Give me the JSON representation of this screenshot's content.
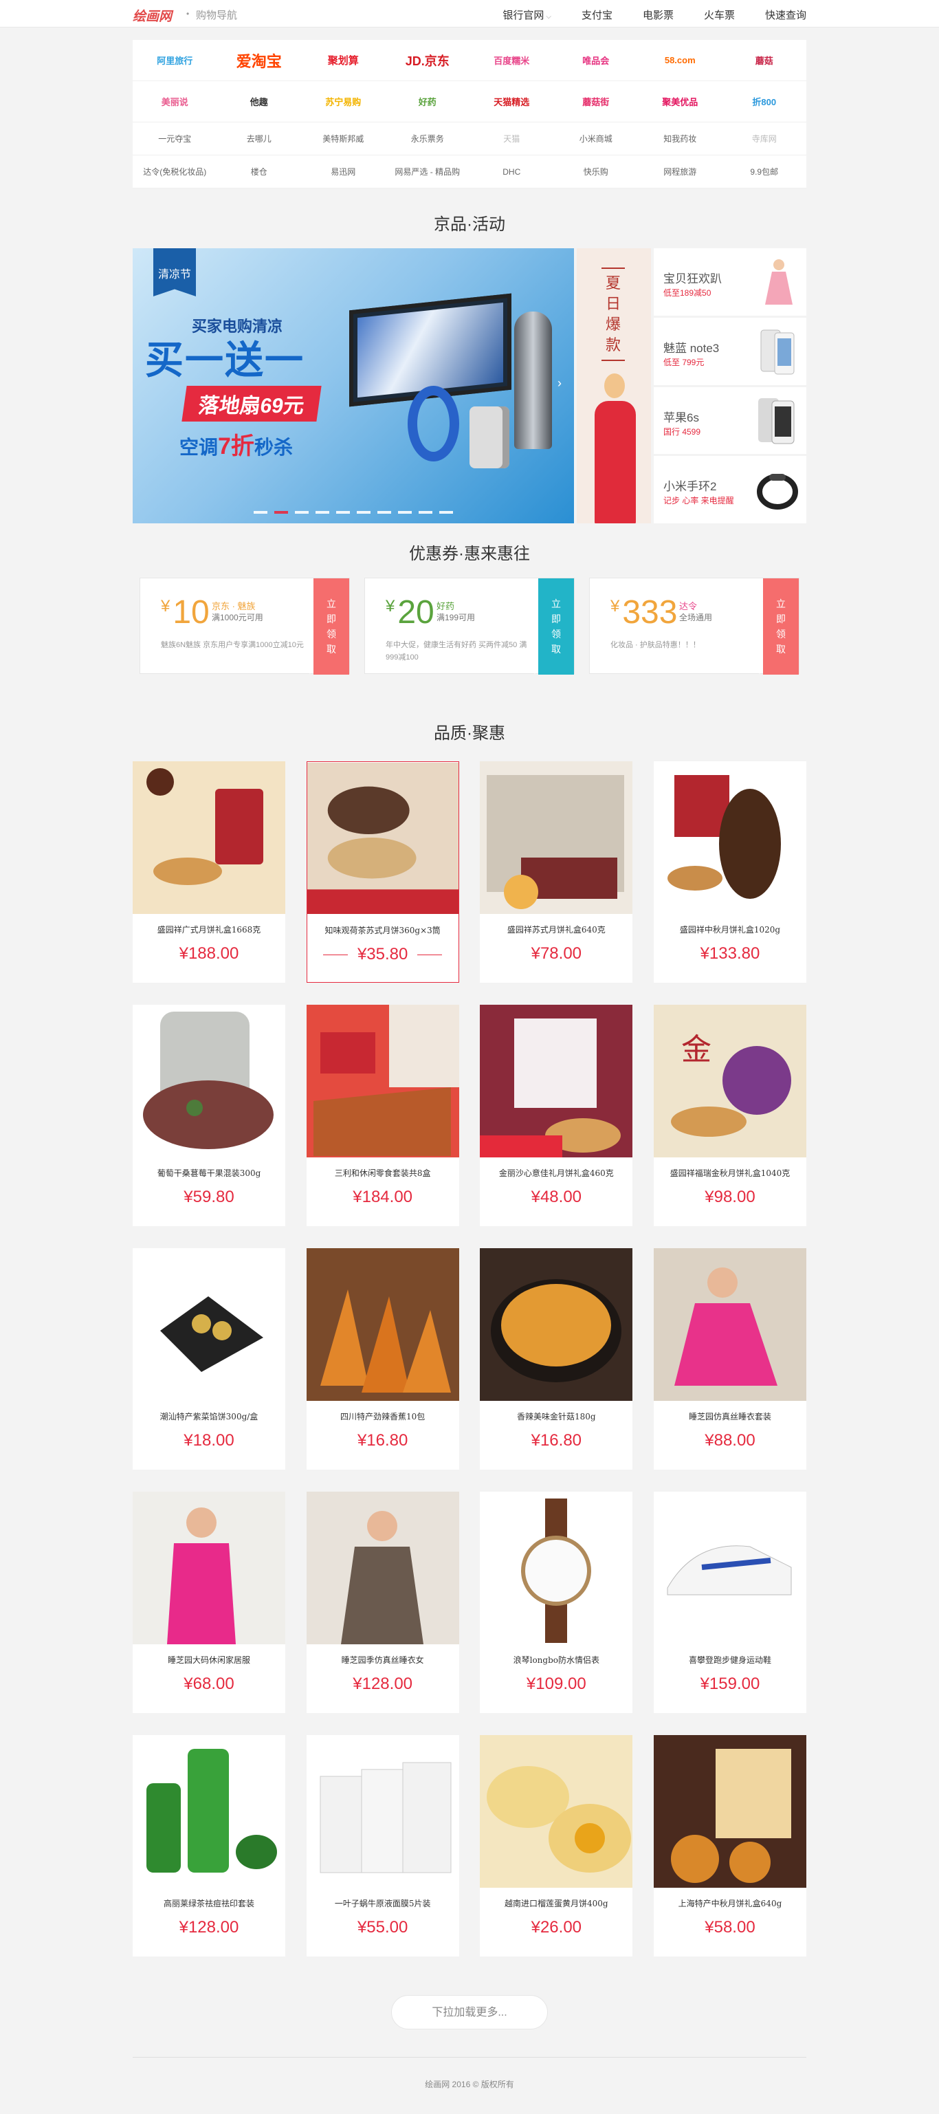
{
  "header": {
    "logo": "绘画网",
    "dot": "•",
    "subtitle": "购物导航",
    "nav": [
      {
        "label": "银行官网",
        "caret": "⌵"
      },
      {
        "label": "支付宝"
      },
      {
        "label": "电影票"
      },
      {
        "label": "火车票"
      },
      {
        "label": "快速查询"
      }
    ]
  },
  "sites": {
    "logo_row_1": [
      {
        "label": "阿里旅行",
        "color": "#31a3e0"
      },
      {
        "label": "爱淘宝",
        "color": "#ff4400"
      },
      {
        "label": "聚划算",
        "color": "#e61e2c"
      },
      {
        "label": "JD.京东",
        "color": "#d71c24"
      },
      {
        "label": "百度糯米",
        "color": "#e8478b"
      },
      {
        "label": "唯品会",
        "color": "#e63280"
      },
      {
        "label": "58.com",
        "color": "#ff6b00"
      },
      {
        "label": "蘑菇",
        "color": "#c9284b"
      }
    ],
    "logo_row_2": [
      {
        "label": "美丽说",
        "color": "#e95c8f"
      },
      {
        "label": "他趣",
        "color": "#333333"
      },
      {
        "label": "苏宁易购",
        "color": "#f3b400"
      },
      {
        "label": "好药",
        "color": "#5aa33d"
      },
      {
        "label": "天猫精选",
        "color": "#d71d24"
      },
      {
        "label": "蘑菇街",
        "color": "#e62e6b"
      },
      {
        "label": "聚美优品",
        "color": "#e3155f"
      },
      {
        "label": "折800",
        "color": "#2a98dc"
      }
    ],
    "text_row_1": [
      "一元夺宝",
      "去哪儿",
      "美特斯邦威",
      "永乐票务",
      "天猫",
      "小米商城",
      "知我药妆",
      "寺库网"
    ],
    "text_row_2": [
      "达令(免税化妆品)",
      "楼仓",
      "易迅网",
      "网易严选 - 精品购",
      "DHC",
      "快乐购",
      "网程旅游",
      "9.9包邮"
    ]
  },
  "activity": {
    "title": "京品·活动",
    "banner": {
      "badge": "清凉节",
      "line1": "买家电购清凉",
      "line2": "买一送一",
      "line3": "落地扇69元",
      "line4_a": "空调",
      "line4_b": "7折",
      "line4_c": "秒杀",
      "arrow": "›"
    },
    "summer_text": "夏日爆款",
    "side_goods": [
      {
        "title": "宝贝狂欢趴",
        "price": "低至189减50"
      },
      {
        "title": "魅蓝 note3",
        "price": "低至 799元"
      },
      {
        "title": "苹果6s",
        "price": "国行 4599"
      },
      {
        "title": "小米手环2",
        "price": "记步 心率 来电提醒"
      }
    ]
  },
  "coupons": {
    "title": "优惠券·惠来惠往",
    "items": [
      {
        "symbol": "¥",
        "amount": "10",
        "brand": "京东 · 魅族",
        "cond": "满1000元可用",
        "desc": "魅族6N魅族 京东用户专享满1000立减10元",
        "cta": "立即领取",
        "color": "#f56d6d"
      },
      {
        "symbol": "¥",
        "amount": "20",
        "brand": "好药",
        "cond": "满199可用",
        "desc": "年中大促，健康生活有好药 买两件减50 满999减100",
        "cta": "立即领取",
        "color": "#22b4c8"
      },
      {
        "symbol": "¥",
        "amount": "333",
        "brand": "达令",
        "cond": "全场通用",
        "desc": "化妆品 · 护肤品特惠！！！",
        "cta": "立即领取",
        "color": "#f56d6d"
      }
    ]
  },
  "products": {
    "title": "品质·聚惠",
    "items": [
      {
        "name": "盛园祥广式月饼礼盒1668克",
        "price": "¥188.00"
      },
      {
        "name": "知味观荷茶苏式月饼360g×3筒",
        "price": "¥35.80"
      },
      {
        "name": "盛园祥苏式月饼礼盒640克",
        "price": "¥78.00"
      },
      {
        "name": "盛园祥中秋月饼礼盒1020g",
        "price": "¥133.80"
      },
      {
        "name": "葡萄干桑葚莓干果混装300g",
        "price": "¥59.80"
      },
      {
        "name": "三利和休闲零食套装共8盒",
        "price": "¥184.00"
      },
      {
        "name": "金丽沙心意佳礼月饼礼盒460克",
        "price": "¥48.00"
      },
      {
        "name": "盛园祥福瑞金秋月饼礼盒1040克",
        "price": "¥98.00"
      },
      {
        "name": "潮汕特产紫菜馅饼300g/盒",
        "price": "¥18.00"
      },
      {
        "name": "四川特产劲辣香蕉10包",
        "price": "¥16.80"
      },
      {
        "name": "香辣美味金针菇180g",
        "price": "¥16.80"
      },
      {
        "name": "睡芝园仿真丝睡衣套装",
        "price": "¥88.00"
      },
      {
        "name": "睡芝园大码休闲家居服",
        "price": "¥68.00"
      },
      {
        "name": "睡芝园季仿真丝睡衣女",
        "price": "¥128.00"
      },
      {
        "name": "浪琴longbo防水情侣表",
        "price": "¥109.00"
      },
      {
        "name": "喜攀登跑步健身运动鞋",
        "price": "¥159.00"
      },
      {
        "name": "高丽莱绿茶祛痘祛印套装",
        "price": "¥128.00"
      },
      {
        "name": "一叶子蜗牛原液面膜5片装",
        "price": "¥55.00"
      },
      {
        "name": "越南进口榴莲蛋黄月饼400g",
        "price": "¥26.00"
      },
      {
        "name": "上海特产中秋月饼礼盒640g",
        "price": "¥58.00"
      }
    ]
  },
  "load_more": "下拉加载更多...",
  "footer": "绘画网 2016 © 版权所有"
}
